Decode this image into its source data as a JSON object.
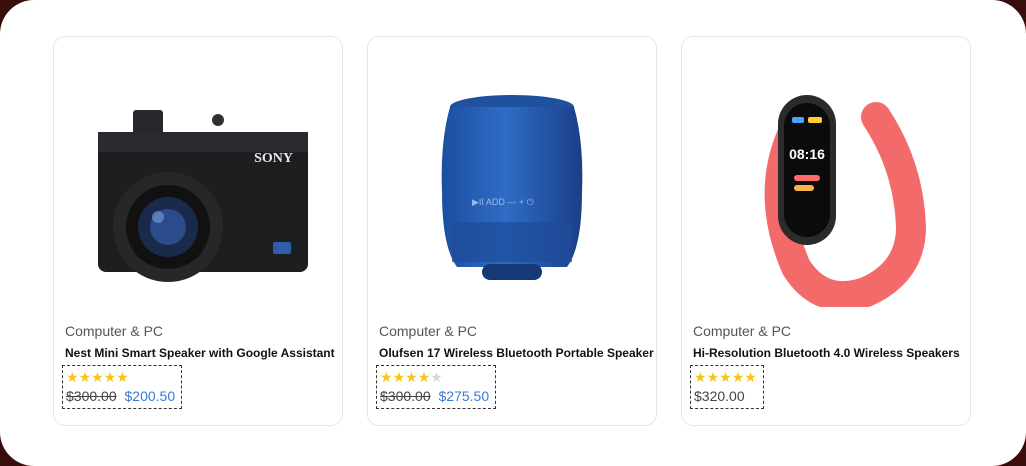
{
  "products": [
    {
      "category": "Computer & PC",
      "name": "Nest Mini Smart Speaker with Google Assistant",
      "rating": 5,
      "old_price": "$300.00",
      "price": "$200.50",
      "image": "compact-camera",
      "brand_mark": "SONY"
    },
    {
      "category": "Computer & PC",
      "name": "Olufsen 17 Wireless Bluetooth Portable Speaker",
      "rating": 4,
      "old_price": "$300.00",
      "price": "$275.50",
      "image": "bluetooth-speaker"
    },
    {
      "category": "Computer & PC",
      "name": "Hi-Resolution Bluetooth 4.0 Wireless Speakers",
      "rating": 5,
      "price": "$320.00",
      "image": "fitness-band",
      "watch_time": "08:16"
    }
  ],
  "colors": {
    "star": "#f5c518",
    "sale_price": "#3a7bd5",
    "card_border": "#e6e6e6"
  }
}
